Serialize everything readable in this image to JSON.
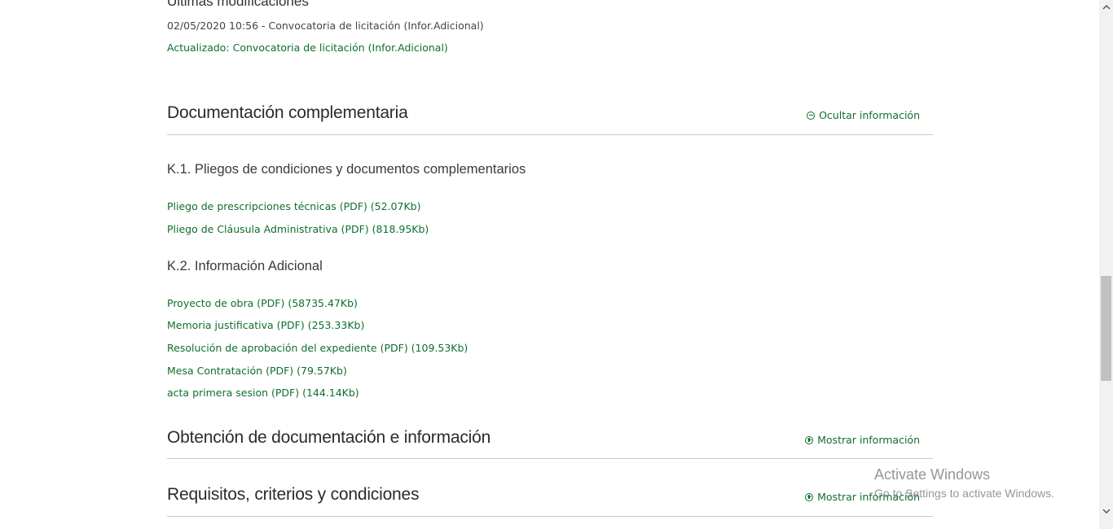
{
  "last_modified": {
    "heading": "Últimas modificaciones",
    "entry_date": "02/05/2020 10:56 - Convocatoria de licitación (Infor.Adicional)",
    "entry_updated": "Actualizado: Convocatoria de licitación (Infor.Adicional)"
  },
  "doc_section": {
    "title": "Documentación complementaria",
    "toggle_label": "Ocultar información",
    "groups": [
      {
        "title": "K.1. Pliegos de condiciones y documentos complementarios",
        "links": [
          "Pliego de prescripciones técnicas (PDF) (52.07Kb)",
          "Pliego de Cláusula Administrativa (PDF) (818.95Kb)"
        ]
      },
      {
        "title": "K.2. Información Adicional",
        "links": [
          "Proyecto de obra (PDF) (58735.47Kb)",
          "Memoria justificativa (PDF) (253.33Kb)",
          "Resolución de aprobación del expediente (PDF) (109.53Kb)",
          "Mesa Contratación (PDF) (79.57Kb)",
          "acta primera sesion (PDF) (144.14Kb)"
        ]
      }
    ]
  },
  "obtencion_section": {
    "title": "Obtención de documentación e información",
    "toggle_label": "Mostrar información"
  },
  "requisitos_section": {
    "title": "Requisitos, criterios y condiciones",
    "toggle_label": "Mostrar información"
  },
  "watermark": {
    "title": "Activate Windows",
    "subtitle": "Go to Settings to activate Windows."
  },
  "icons": {
    "collapse": "minus-circle-icon",
    "expand": "plus-circle-icon",
    "scroll_up": "chevron-up-icon",
    "scroll_down": "chevron-down-icon"
  },
  "colors": {
    "link_green": "#0f6e2d",
    "heading": "#2b2b2b",
    "rule": "#c8c8c8"
  }
}
